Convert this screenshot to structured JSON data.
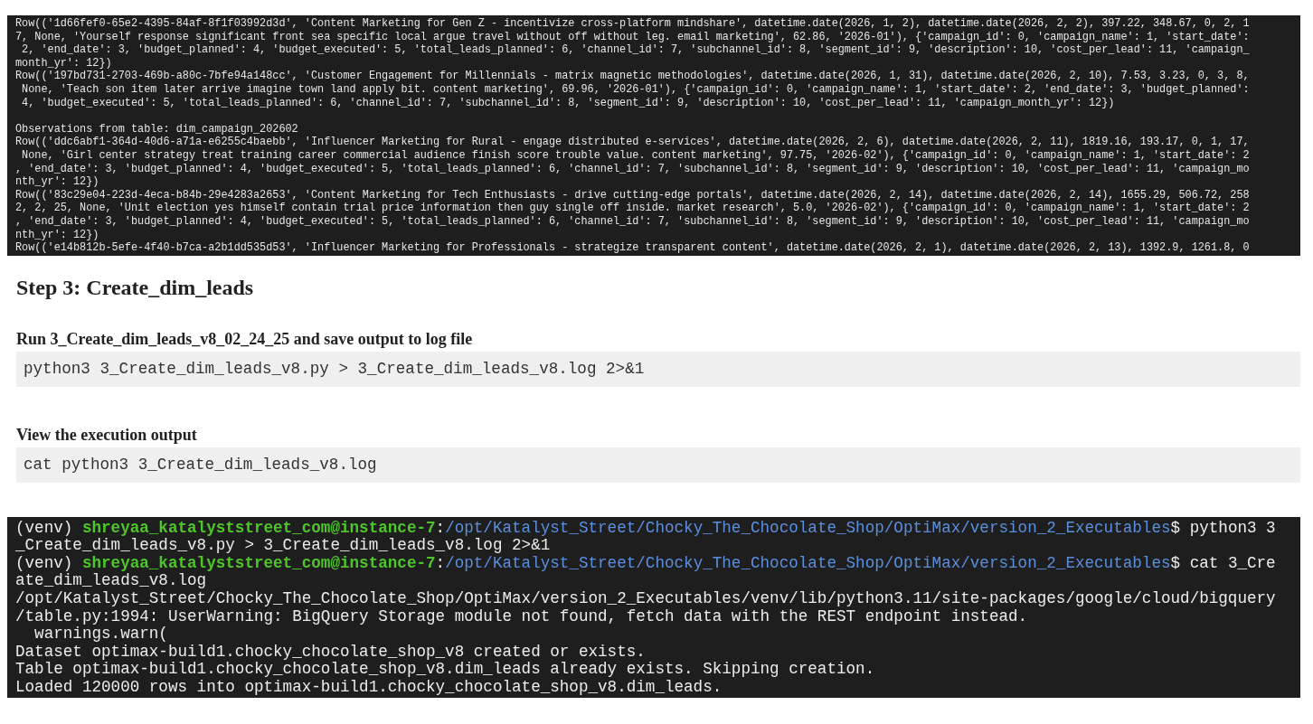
{
  "top_terminal": {
    "lines": [
      "Row(('1d66fef0-65e2-4395-84af-8f1f03992d3d', 'Content Marketing for Gen Z - incentivize cross-platform mindshare', datetime.date(2026, 1, 2), datetime.date(2026, 2, 2), 397.22, 348.67, 0, 2, 1",
      "7, None, 'Yourself response significant front sea specific local argue travel without off without leg. email marketing', 62.86, '2026-01'), {'campaign_id': 0, 'campaign_name': 1, 'start_date':",
      " 2, 'end_date': 3, 'budget_planned': 4, 'budget_executed': 5, 'total_leads_planned': 6, 'channel_id': 7, 'subchannel_id': 8, 'segment_id': 9, 'description': 10, 'cost_per_lead': 11, 'campaign_",
      "month_yr': 12})",
      "Row(('197bd731-2703-469b-a80c-7bfe94a148cc', 'Customer Engagement for Millennials - matrix magnetic methodologies', datetime.date(2026, 1, 31), datetime.date(2026, 2, 10), 7.53, 3.23, 0, 3, 8,",
      " None, 'Teach son item later arrive imagine town land apply bit. content marketing', 69.96, '2026-01'), {'campaign_id': 0, 'campaign_name': 1, 'start_date': 2, 'end_date': 3, 'budget_planned':",
      " 4, 'budget_executed': 5, 'total_leads_planned': 6, 'channel_id': 7, 'subchannel_id': 8, 'segment_id': 9, 'description': 10, 'cost_per_lead': 11, 'campaign_month_yr': 12})",
      {
        "kind": "section",
        "text": "Observations from table: dim_campaign_202602"
      },
      "Row(('ddc6abf1-364d-40d6-a71a-e6255c4baebb', 'Influencer Marketing for Rural - engage distributed e-services', datetime.date(2026, 2, 6), datetime.date(2026, 2, 11), 1819.16, 193.17, 0, 1, 17,",
      " None, 'Girl center strategy treat training career commercial audience finish score trouble value. content marketing', 97.75, '2026-02'), {'campaign_id': 0, 'campaign_name': 1, 'start_date': 2",
      ", 'end_date': 3, 'budget_planned': 4, 'budget_executed': 5, 'total_leads_planned': 6, 'channel_id': 7, 'subchannel_id': 8, 'segment_id': 9, 'description': 10, 'cost_per_lead': 11, 'campaign_mo",
      "nth_yr': 12})",
      "Row(('83c29e04-223d-4eca-b84b-29e4283a2653', 'Content Marketing for Tech Enthusiasts - drive cutting-edge portals', datetime.date(2026, 2, 14), datetime.date(2026, 2, 14), 1655.29, 506.72, 258",
      "2, 2, 25, None, 'Unit election yes himself contain trial price information then guy single off inside. market research', 5.0, '2026-02'), {'campaign_id': 0, 'campaign_name': 1, 'start_date': 2",
      ", 'end_date': 3, 'budget_planned': 4, 'budget_executed': 5, 'total_leads_planned': 6, 'channel_id': 7, 'subchannel_id': 8, 'segment_id': 9, 'description': 10, 'cost_per_lead': 11, 'campaign_mo",
      "nth_yr': 12})",
      "Row(('e14b812b-5efe-4f40-b7ca-a2b1dd535d53', 'Influencer Marketing for Professionals - strategize transparent content', datetime.date(2026, 2, 1), datetime.date(2026, 2, 13), 1392.9, 1261.8, 0"
    ]
  },
  "heading": "Step 3: Create_dim_leads",
  "steps": [
    {
      "label": "Run 3_Create_dim_leads_v8_02_24_25 and save output to log file",
      "command": "python3 3_Create_dim_leads_v8.py > 3_Create_dim_leads_v8.log 2>&1"
    },
    {
      "label": "View the execution output",
      "command": "cat python3 3_Create_dim_leads_v8.log"
    }
  ],
  "bottom_terminal": {
    "lines": [
      [
        {
          "kind": "plain",
          "text": "(venv) "
        },
        {
          "kind": "user",
          "text": "shreyaa_katalyststreet_com@instance-7"
        },
        {
          "kind": "plain",
          "text": ":"
        },
        {
          "kind": "path",
          "text": "/opt/Katalyst_Street/Chocky_The_Chocolate_Shop/OptiMax/version_2_Executables"
        },
        {
          "kind": "plain",
          "text": "$ python3 3"
        }
      ],
      [
        {
          "kind": "plain",
          "text": "_Create_dim_leads_v8.py > 3_Create_dim_leads_v8.log 2>&1"
        }
      ],
      [
        {
          "kind": "plain",
          "text": "(venv) "
        },
        {
          "kind": "user",
          "text": "shreyaa_katalyststreet_com@instance-7"
        },
        {
          "kind": "plain",
          "text": ":"
        },
        {
          "kind": "path",
          "text": "/opt/Katalyst_Street/Chocky_The_Chocolate_Shop/OptiMax/version_2_Executables"
        },
        {
          "kind": "plain",
          "text": "$ cat 3_Cre"
        }
      ],
      [
        {
          "kind": "plain",
          "text": "ate_dim_leads_v8.log"
        }
      ],
      [
        {
          "kind": "plain",
          "text": "/opt/Katalyst_Street/Chocky_The_Chocolate_Shop/OptiMax/version_2_Executables/venv/lib/python3.11/site-packages/google/cloud/bigquery"
        }
      ],
      [
        {
          "kind": "plain",
          "text": "/table.py:1994: UserWarning: BigQuery Storage module not found, fetch data with the REST endpoint instead."
        }
      ],
      [
        {
          "kind": "plain",
          "text": "  warnings.warn("
        }
      ],
      [
        {
          "kind": "plain",
          "text": "Dataset optimax-build1.chocky_chocolate_shop_v8 created or exists."
        }
      ],
      [
        {
          "kind": "plain",
          "text": "Table optimax-build1.chocky_chocolate_shop_v8.dim_leads already exists. Skipping creation."
        }
      ],
      [
        {
          "kind": "plain",
          "text": "Loaded 120000 rows into optimax-build1.chocky_chocolate_shop_v8.dim_leads."
        }
      ]
    ]
  }
}
